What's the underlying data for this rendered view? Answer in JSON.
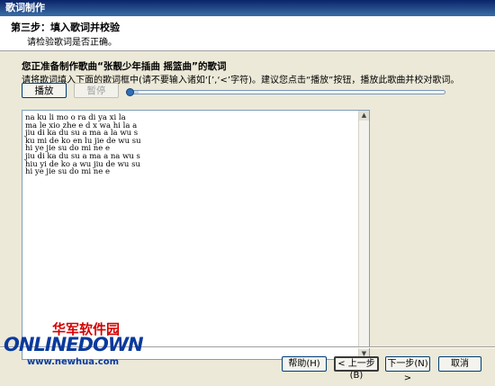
{
  "window": {
    "title": "歌词制作"
  },
  "header": {
    "step_title": "第三步：填入歌词并校验",
    "step_subtitle": "请检验歌词是否正确。"
  },
  "main": {
    "song_heading": "您正准备制作歌曲“张靓少年插曲 摇篮曲”的歌词",
    "instruction": "请将歌词填入下面的歌词框中(请不要输入诸如‘[’,‘<’字符)。建议您点击“播放”按钮，播放此歌曲并校对歌词。",
    "play_label": "播放",
    "pause_label": "暂停",
    "progress_fraction": 0.03,
    "lyrics": [
      "na ku li mo o ra di ya xi la",
      "ma le xio zhe e d x wa hi la a",
      "jiu di ka du su a ma a la wu s",
      "ku mi de ko en lu jie de wu su",
      "hi ye jie su do mi ne e",
      "jiu di ka du su a ma a na wu s",
      "hiu yi de ko a wu jiu de wu su",
      "hi ye jie su do mi ne e"
    ]
  },
  "footer": {
    "help_label": "帮助(H)",
    "back_label": "< 上一步(B)",
    "next_label": "下一步(N) >",
    "cancel_label": "取消"
  },
  "watermark": {
    "cn": "华军软件园",
    "en": "ONLINEDOWN",
    "url": "www.newhua.com"
  },
  "colors": {
    "titlebar": "#0a246a",
    "dialog_bg": "#ece9d8",
    "accent": "#003c74"
  }
}
